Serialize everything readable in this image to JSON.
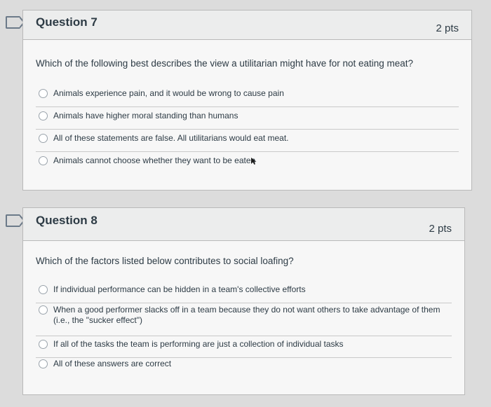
{
  "questions": [
    {
      "title": "Question 7",
      "points": "2 pts",
      "text": "Which of the following best describes the view a utilitarian might have for not eating meat?",
      "answers": [
        "Animals experience pain, and it would be wrong to cause pain",
        "Animals have higher moral standing than humans",
        "All of these statements are false. All utilitarians would eat meat.",
        "Animals cannot choose whether they want to be eaten"
      ]
    },
    {
      "title": "Question 8",
      "points": "2 pts",
      "text": "Which of the factors listed below contributes to social loafing?",
      "answers": [
        "If individual performance can be hidden in a team's collective efforts",
        "When a good performer slacks off in a team because they do not want others to take advantage of them (i.e., the \"sucker effect\")",
        "If all of the tasks the team is performing are just a collection of individual tasks",
        "All of these answers are correct"
      ]
    }
  ],
  "icons": {
    "flag": "flag-question-icon",
    "radio": "radio-unselected-icon",
    "cursor": "mouse-pointer-icon"
  }
}
